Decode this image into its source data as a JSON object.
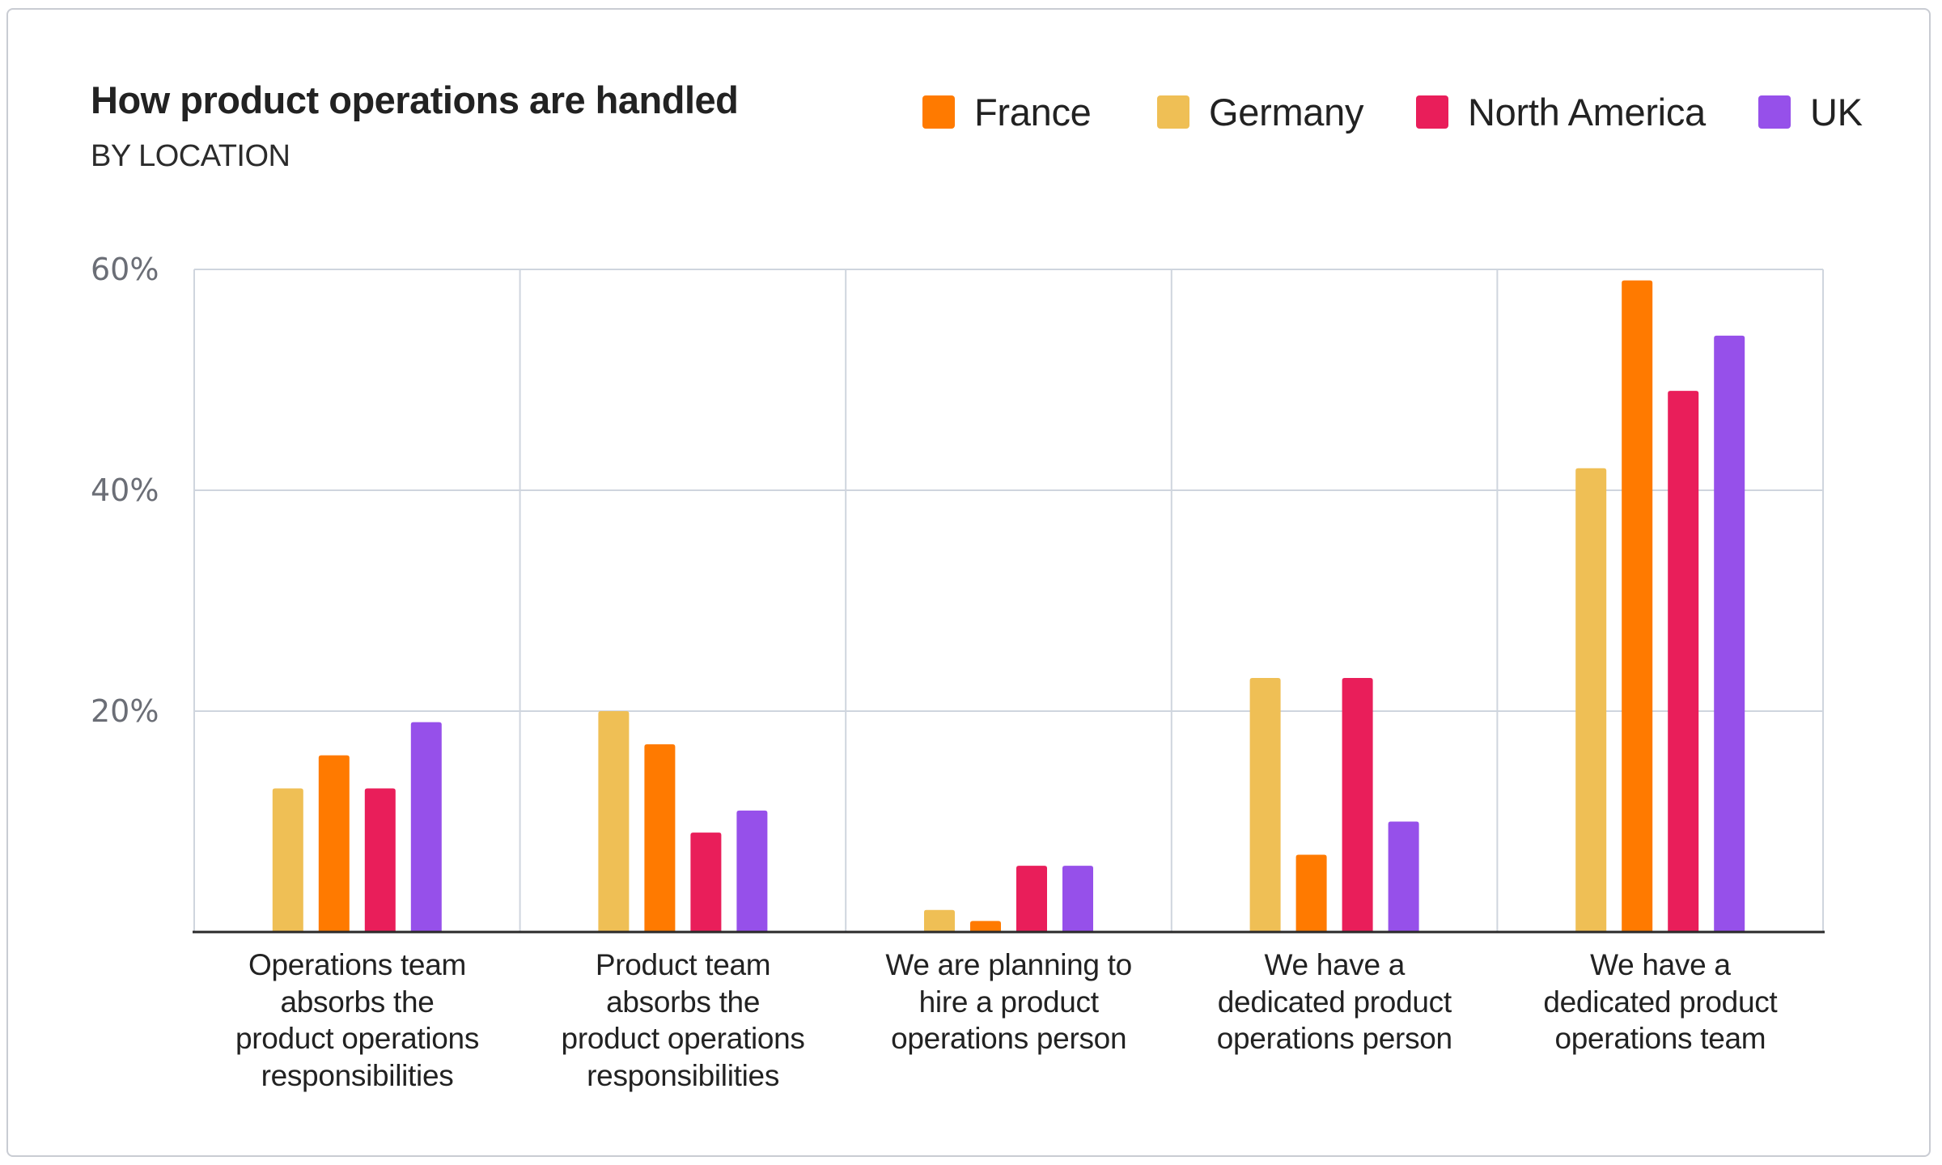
{
  "chart_data": {
    "type": "bar",
    "title": "How product operations are handled",
    "subtitle": "BY LOCATION",
    "xlabel": "",
    "ylabel": "",
    "ylim": [
      0,
      60
    ],
    "yticks": [
      20,
      40,
      60
    ],
    "ytick_labels": [
      "20%",
      "40%",
      "60%"
    ],
    "grid": true,
    "legend_position": "top-right",
    "legend": [
      {
        "name": "France",
        "color": "#ff7a00"
      },
      {
        "name": "Germany",
        "color": "#efbf55"
      },
      {
        "name": "North America",
        "color": "#e91e5a"
      },
      {
        "name": "UK",
        "color": "#9650ea"
      }
    ],
    "bar_order": [
      "Germany",
      "France",
      "North America",
      "UK"
    ],
    "categories": [
      [
        "Operations team",
        "absorbs the",
        "product operations",
        "responsibilities"
      ],
      [
        "Product team",
        "absorbs the",
        "product operations",
        "responsibilities"
      ],
      [
        "We are planning to",
        "hire a product",
        "operations person"
      ],
      [
        "We have a",
        "dedicated product",
        "operations person"
      ],
      [
        "We have a",
        "dedicated product",
        "operations team"
      ]
    ],
    "series": [
      {
        "name": "Germany",
        "color": "#efbf55",
        "values": [
          13,
          20,
          2,
          23,
          42
        ]
      },
      {
        "name": "France",
        "color": "#ff7a00",
        "values": [
          16,
          17,
          1,
          7,
          59
        ]
      },
      {
        "name": "North America",
        "color": "#e91e5a",
        "values": [
          13,
          9,
          6,
          23,
          49
        ]
      },
      {
        "name": "UK",
        "color": "#9650ea",
        "values": [
          19,
          11,
          6,
          10,
          54
        ]
      }
    ]
  }
}
